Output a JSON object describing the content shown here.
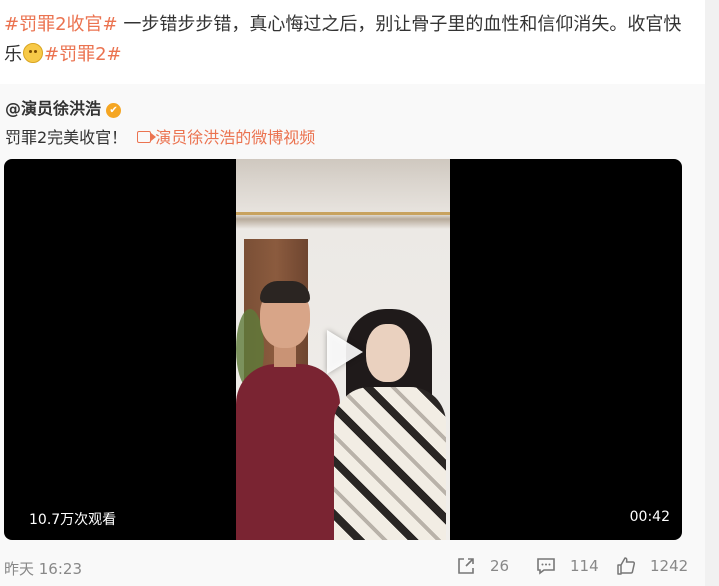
{
  "post": {
    "topic1": "#罚罪2收官#",
    "body": " 一步错步步错，真心悔过之后，别让骨子里的血性和信仰消失。收官快乐",
    "emoji_name": "party-face-emoji",
    "topic2": "#罚罪2#"
  },
  "repost": {
    "author": "@演员徐洪浩",
    "verified_icon": "verified-badge-icon",
    "text": "罚罪2完美收官！",
    "video_link": "演员徐洪浩的微博视频"
  },
  "video": {
    "views": "10.7万次观看",
    "duration": "00:42"
  },
  "footer": {
    "time": "昨天 16:23",
    "reposts": "26",
    "comments": "114",
    "likes": "1242"
  },
  "colors": {
    "accent": "#eb7350",
    "verified": "#f5a623"
  }
}
